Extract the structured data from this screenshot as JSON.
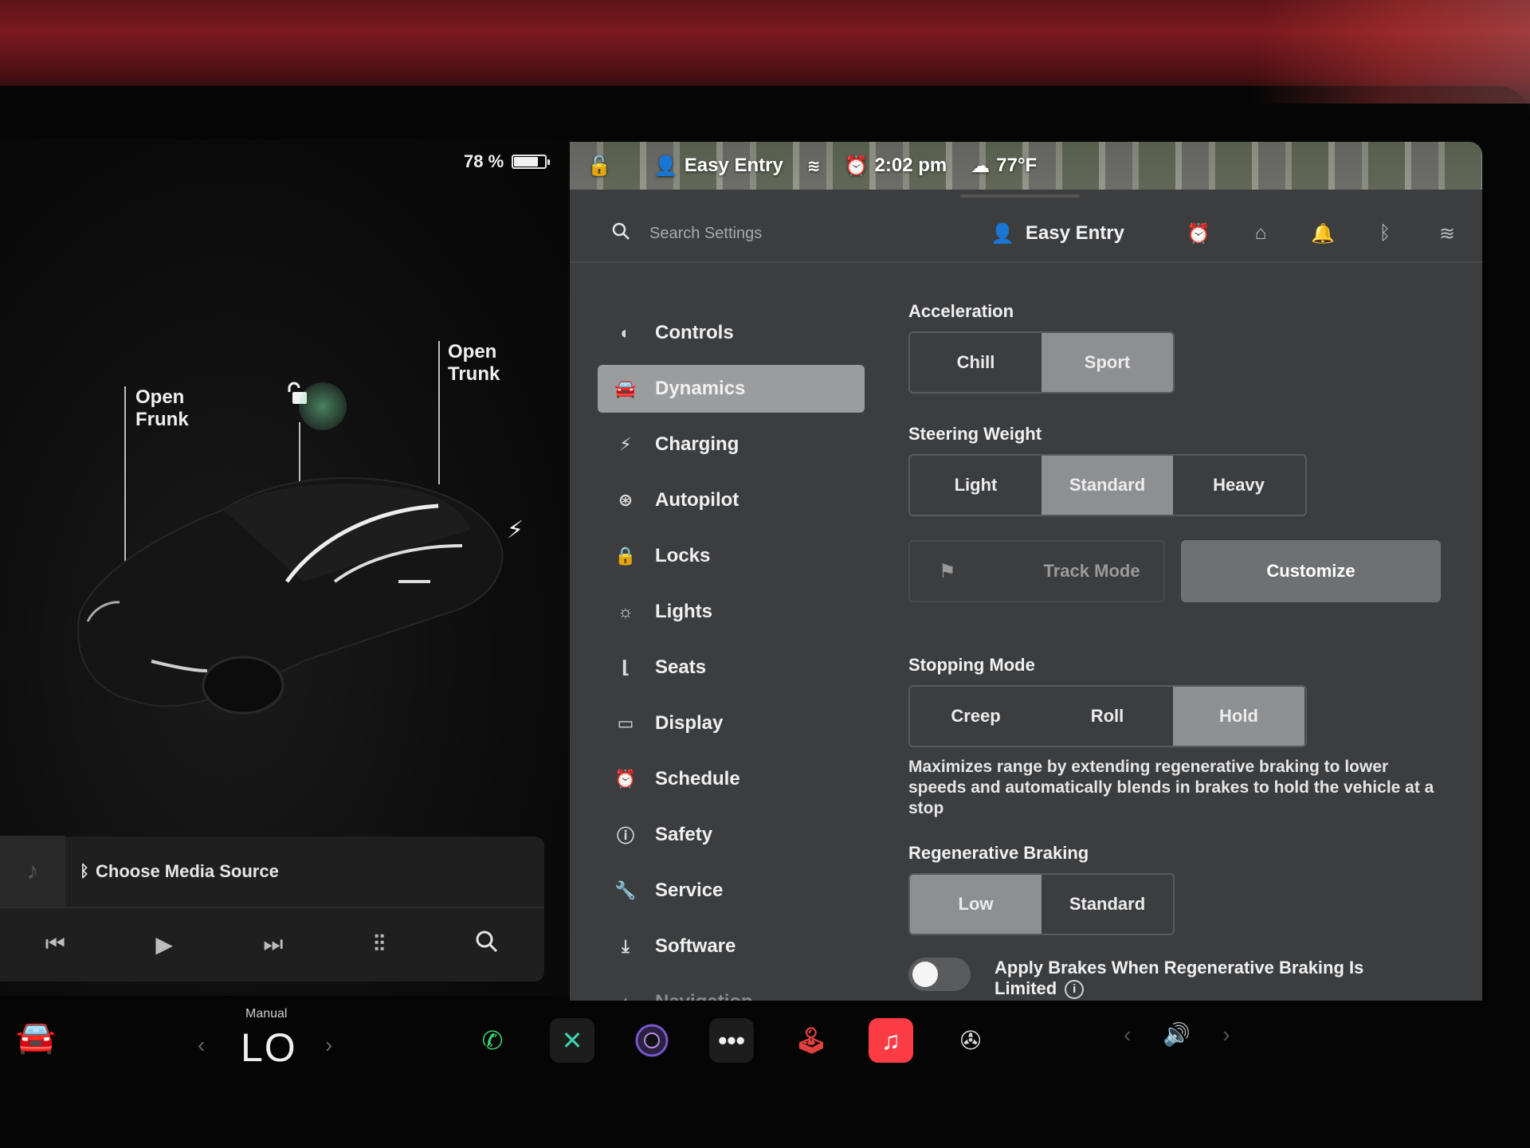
{
  "status": {
    "battery_percent": "78 %",
    "battery_level": 0.78,
    "profile": "Easy Entry",
    "time": "2:02 pm",
    "temperature": "77°F"
  },
  "car_view": {
    "frunk_label_line1": "Open",
    "frunk_label_line2": "Frunk",
    "trunk_label_line1": "Open",
    "trunk_label_line2": "Trunk"
  },
  "media": {
    "source_label": "Choose Media Source"
  },
  "search": {
    "placeholder": "Search Settings"
  },
  "topbar": {
    "profile": "Easy Entry"
  },
  "nav": {
    "items": [
      {
        "label": "Controls",
        "icon": "toggle-icon"
      },
      {
        "label": "Dynamics",
        "icon": "car-icon",
        "active": true
      },
      {
        "label": "Charging",
        "icon": "bolt-icon"
      },
      {
        "label": "Autopilot",
        "icon": "steering-wheel-icon"
      },
      {
        "label": "Locks",
        "icon": "lock-icon"
      },
      {
        "label": "Lights",
        "icon": "sun-icon"
      },
      {
        "label": "Seats",
        "icon": "seat-icon"
      },
      {
        "label": "Display",
        "icon": "display-icon"
      },
      {
        "label": "Schedule",
        "icon": "alarm-clock-icon"
      },
      {
        "label": "Safety",
        "icon": "alert-circle-icon"
      },
      {
        "label": "Service",
        "icon": "wrench-icon"
      },
      {
        "label": "Software",
        "icon": "download-icon"
      },
      {
        "label": "Navigation",
        "icon": "navigation-arrow-icon"
      }
    ]
  },
  "dynamics": {
    "acceleration": {
      "title": "Acceleration",
      "options": [
        "Chill",
        "Sport"
      ],
      "selected": "Sport"
    },
    "steering_weight": {
      "title": "Steering Weight",
      "options": [
        "Light",
        "Standard",
        "Heavy"
      ],
      "selected": "Standard"
    },
    "track_mode": {
      "label": "Track Mode",
      "customize_label": "Customize"
    },
    "stopping_mode": {
      "title": "Stopping Mode",
      "options": [
        "Creep",
        "Roll",
        "Hold"
      ],
      "selected": "Hold",
      "description": "Maximizes range by extending regenerative braking to lower speeds and automatically blends in brakes to hold the vehicle at a stop"
    },
    "regen_braking": {
      "title": "Regenerative Braking",
      "options": [
        "Low",
        "Standard"
      ],
      "selected": "Low"
    },
    "apply_brakes_toggle": {
      "label": "Apply Brakes When Regenerative Braking Is Limited",
      "enabled": false
    }
  },
  "climate": {
    "mode": "Manual",
    "temp": "LO"
  },
  "colors": {
    "settings_bg": "#3c3d3f",
    "selected_segment": "#8e8f91",
    "alarm_accent": "#f4a41c",
    "phone_green": "#3bd16f",
    "music_red": "#fc3c44"
  }
}
